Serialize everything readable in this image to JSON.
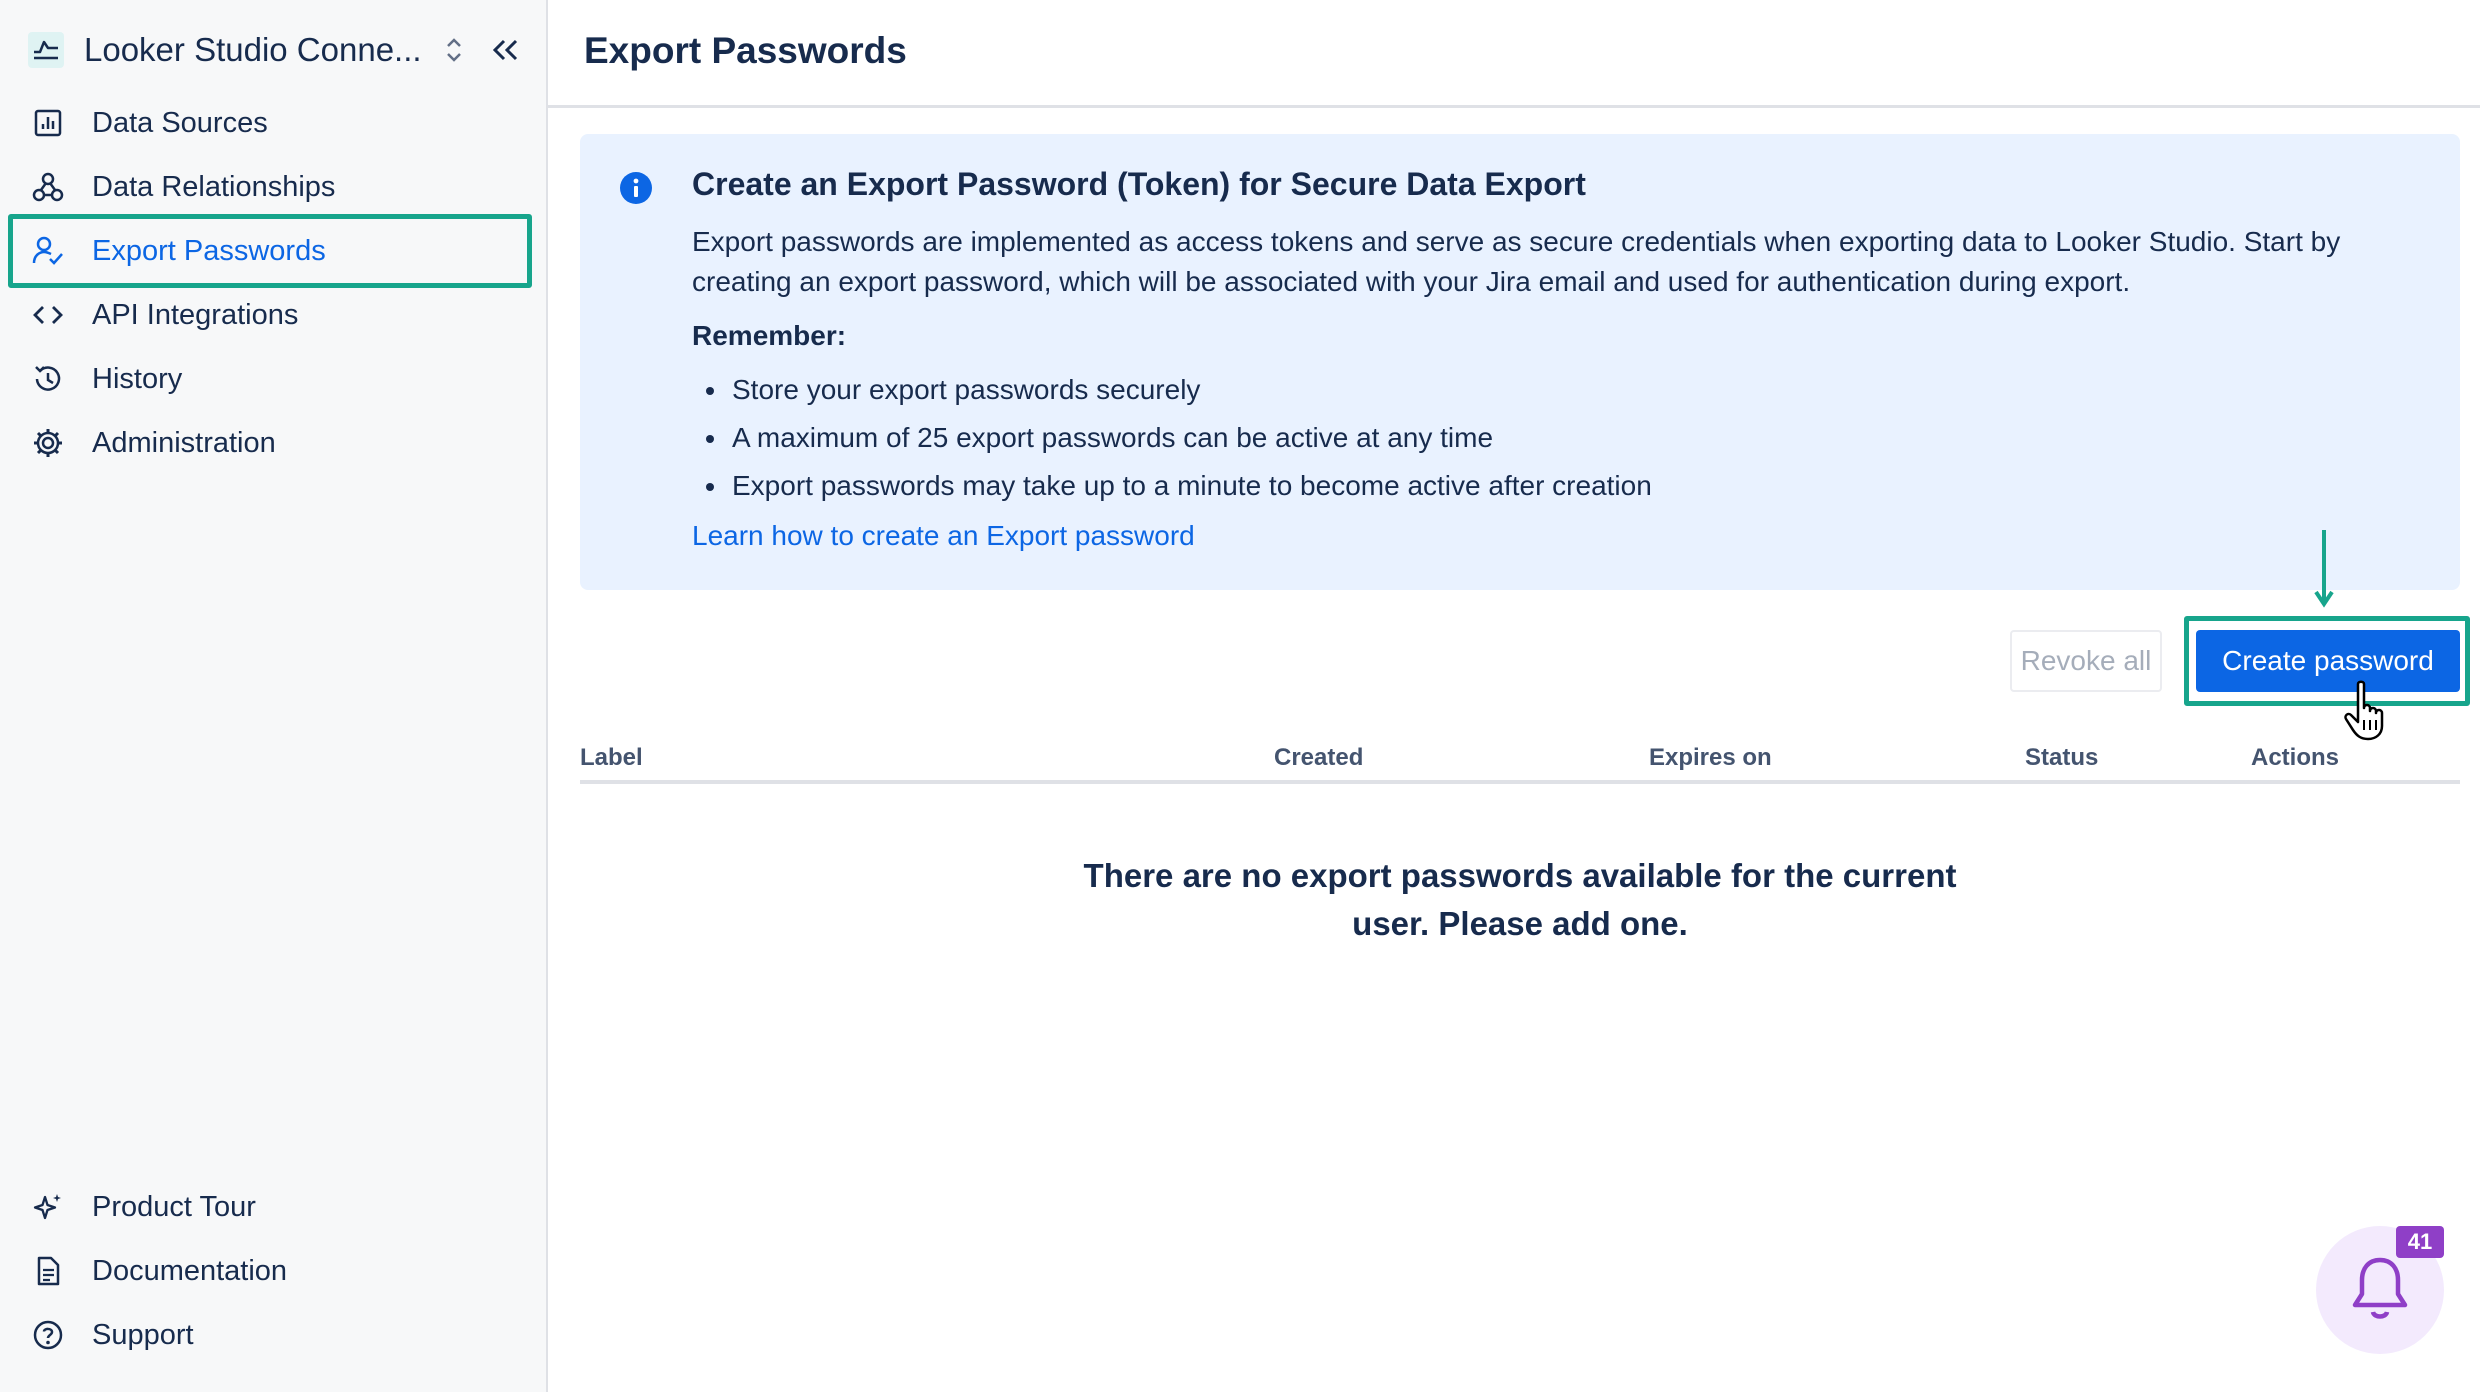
{
  "app": {
    "title": "Looker Studio Conne...",
    "page_title": "Export Passwords"
  },
  "sidebar": {
    "items": [
      {
        "label": "Data Sources",
        "icon": "bar-chart-icon"
      },
      {
        "label": "Data Relationships",
        "icon": "relationships-icon"
      },
      {
        "label": "Export Passwords",
        "icon": "user-check-icon",
        "active": true
      },
      {
        "label": "API Integrations",
        "icon": "code-icon"
      },
      {
        "label": "History",
        "icon": "history-icon"
      },
      {
        "label": "Administration",
        "icon": "gear-icon"
      }
    ],
    "footer_items": [
      {
        "label": "Product Tour",
        "icon": "sparkle-icon"
      },
      {
        "label": "Documentation",
        "icon": "document-icon"
      },
      {
        "label": "Support",
        "icon": "help-icon"
      }
    ]
  },
  "info": {
    "title": "Create an Export Password (Token) for Secure Data Export",
    "description": "Export passwords are implemented as access tokens and serve as secure credentials when exporting data to Looker Studio. Start by creating an export password, which will be associated with your Jira email and used for authentication during export.",
    "remember_label": "Remember:",
    "bullets": [
      "Store your export passwords securely",
      "A maximum of 25 export passwords can be active at any time",
      "Export passwords may take up to a minute to become active after creation"
    ],
    "link_text": "Learn how to create an Export password"
  },
  "actions": {
    "revoke_all": "Revoke all",
    "create_password": "Create password"
  },
  "table": {
    "columns": [
      "Label",
      "Created",
      "Expires on",
      "Status",
      "Actions"
    ],
    "empty_message": "There are no export passwords available for the current user. Please add one."
  },
  "notifications": {
    "count": "41"
  },
  "colors": {
    "accent": "#0c66e4",
    "highlight": "#17a58c",
    "info_background": "#e9f2ff",
    "badge": "#8f3fc7"
  }
}
